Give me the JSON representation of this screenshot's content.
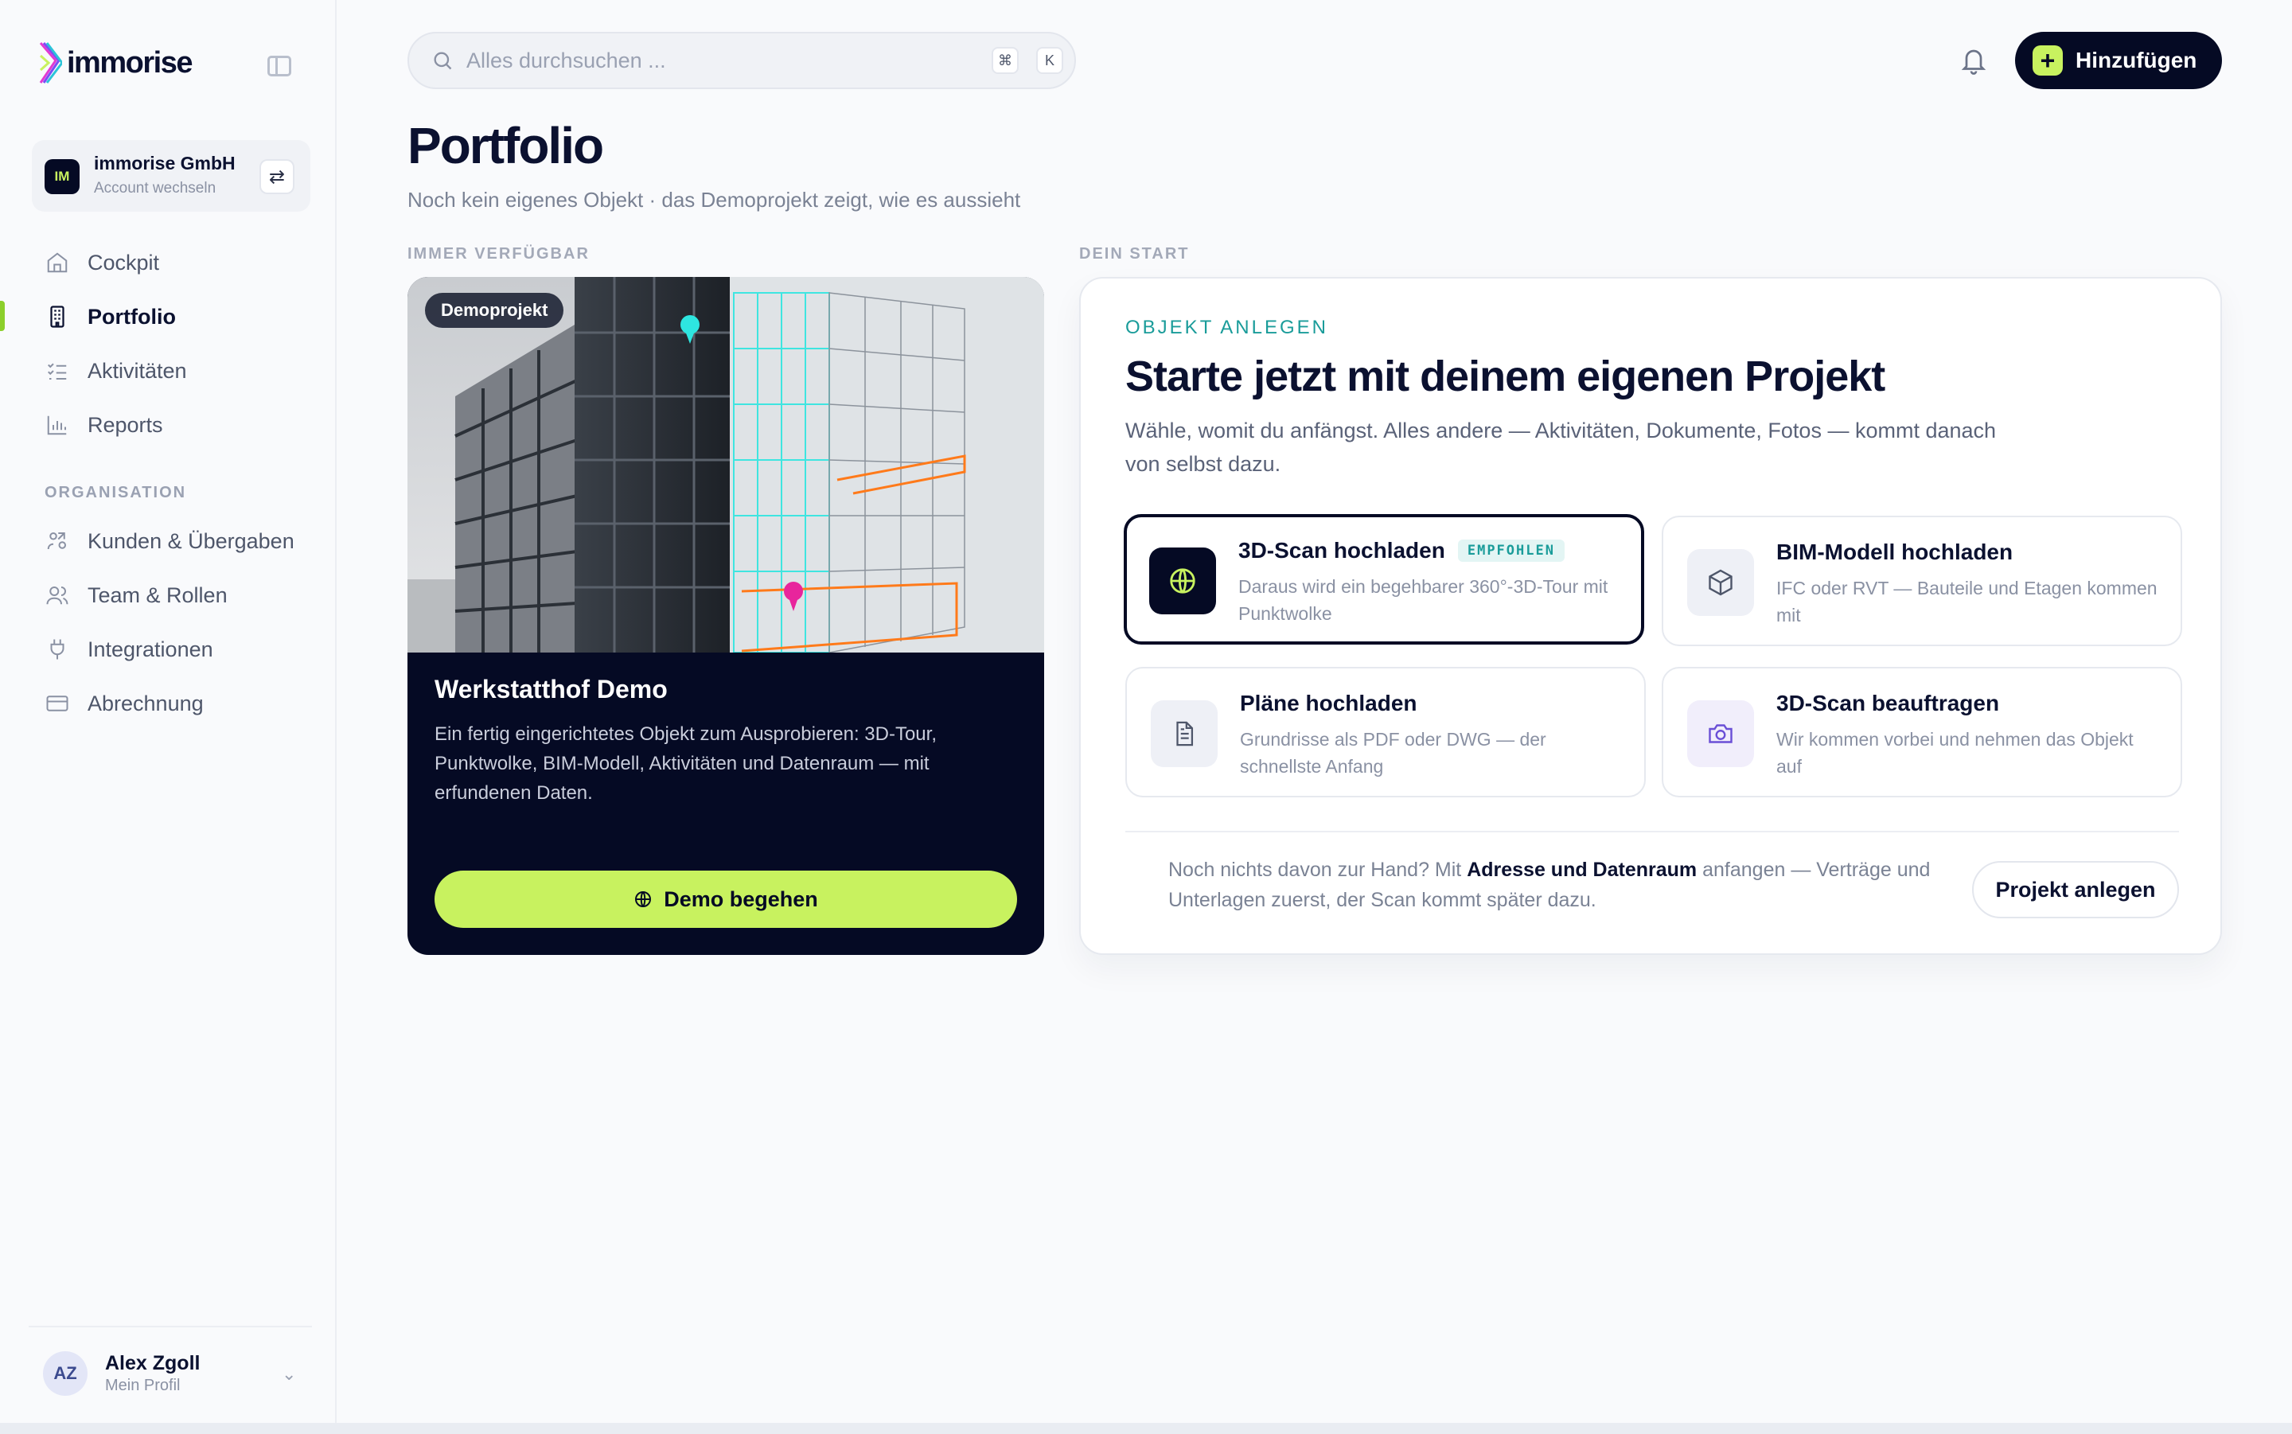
{
  "brand": {
    "name": "immorise"
  },
  "account": {
    "initials": "IM",
    "name": "immorise GmbH",
    "switch_label": "Account wechseln"
  },
  "nav": {
    "items": [
      {
        "label": "Cockpit",
        "icon": "home-icon"
      },
      {
        "label": "Portfolio",
        "icon": "building-icon",
        "active": true
      },
      {
        "label": "Aktivitäten",
        "icon": "checklist-icon"
      },
      {
        "label": "Reports",
        "icon": "bar-chart-icon"
      }
    ],
    "section_label": "ORGANISATION",
    "org_items": [
      {
        "label": "Kunden & Übergaben",
        "icon": "handshake-icon"
      },
      {
        "label": "Team & Rollen",
        "icon": "users-icon"
      },
      {
        "label": "Integrationen",
        "icon": "plug-icon"
      },
      {
        "label": "Abrechnung",
        "icon": "credit-card-icon"
      }
    ]
  },
  "profile": {
    "initials": "AZ",
    "name": "Alex Zgoll",
    "sub": "Mein Profil"
  },
  "search": {
    "placeholder": "Alles durchsuchen ...",
    "shortcut": [
      "⌘",
      "K"
    ]
  },
  "header": {
    "add_label": "Hinzufügen"
  },
  "page": {
    "title": "Portfolio",
    "subtitle": "Noch kein eigenes Objekt · das Demoprojekt zeigt, wie es aussieht",
    "left_label": "IMMER VERFÜGBAR",
    "right_label": "DEIN START"
  },
  "demo": {
    "badge": "Demoprojekt",
    "title": "Werkstatthof Demo",
    "description": "Ein fertig eingerichtetes Objekt zum Ausprobieren: 3D-Tour, Punktwolke, BIM-Modell, Aktivitäten und Datenraum — mit erfundenen Daten.",
    "button": "Demo begehen"
  },
  "start": {
    "eyebrow": "OBJEKT ANLEGEN",
    "title": "Starte jetzt mit deinem eigenen Projekt",
    "description": "Wähle, womit du anfängst. Alles andere — Aktivitäten, Dokumente, Fotos — kommt danach von selbst dazu.",
    "options": [
      {
        "title": "3D-Scan hochladen",
        "badge": "EMPFOHLEN",
        "desc": "Daraus wird ein begehbarer 360°-3D-Tour mit Punktwolke",
        "icon": "globe-icon"
      },
      {
        "title": "BIM-Modell hochladen",
        "desc": "IFC oder RVT — Bauteile und Etagen kommen mit",
        "icon": "cube-icon"
      },
      {
        "title": "Pläne hochladen",
        "desc": "Grundrisse als PDF oder DWG — der schnellste Anfang",
        "icon": "document-icon"
      },
      {
        "title": "3D-Scan beauftragen",
        "desc": "Wir kommen vorbei und nehmen das Objekt auf",
        "icon": "camera-icon"
      }
    ],
    "footer_pre": "Noch nichts davon zur Hand? Mit ",
    "footer_bold": "Adresse und Datenraum",
    "footer_post": " anfangen — Verträge und Unterlagen zuerst, der Scan kommt später dazu.",
    "project_button": "Projekt anlegen"
  },
  "colors": {
    "accent": "#c8f25f",
    "dark": "#050a24",
    "teal": "#1a9c9a",
    "active_bar": "#8ccf2b"
  }
}
